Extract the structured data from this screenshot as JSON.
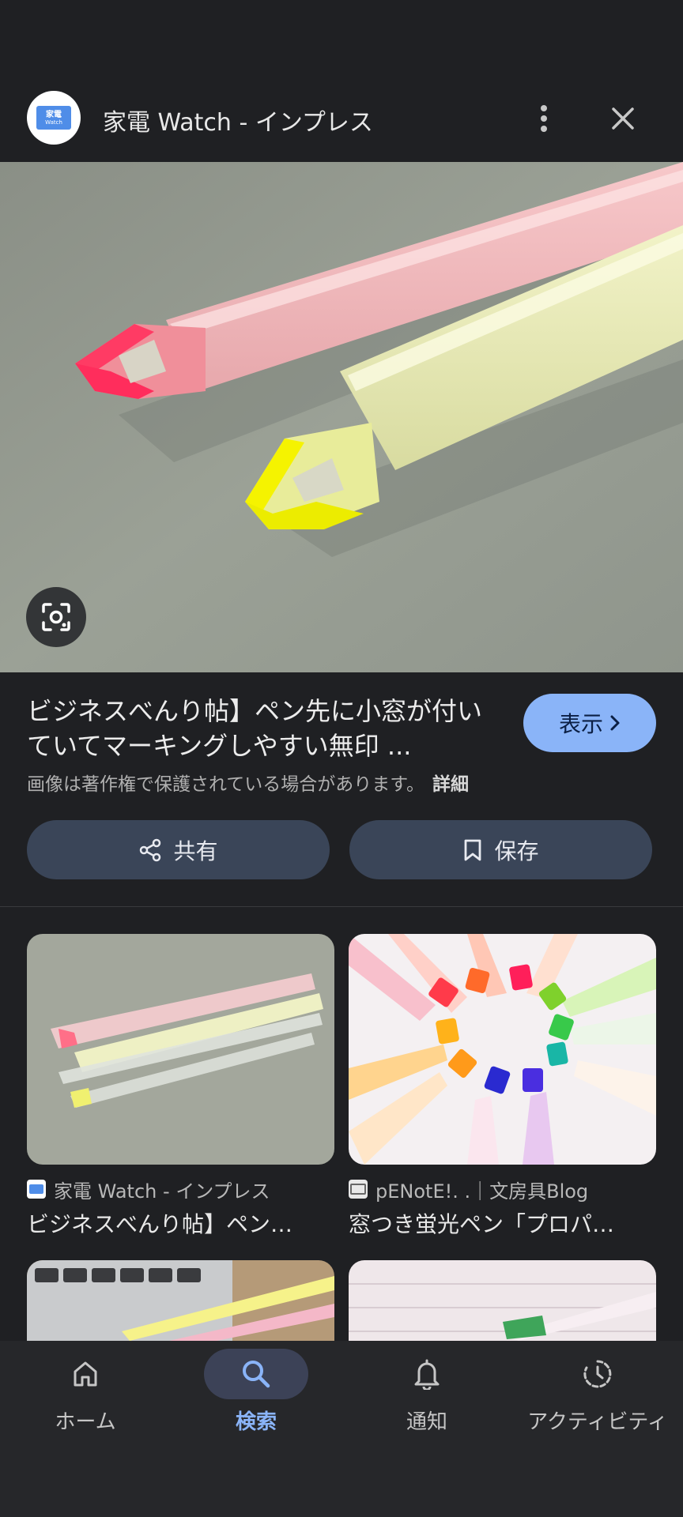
{
  "header": {
    "site_title": "家電 Watch - インプレス",
    "logo_line1": "家電",
    "logo_line2": "Watch"
  },
  "result": {
    "title": "ビジネスべんり帖】ペン先に小窓が付いていてマーキングしやすい無印 ...",
    "view_label": "表示",
    "copyright_notice": "画像は著作権で保護されている場合があります。",
    "details_label": "詳細"
  },
  "actions": {
    "share_label": "共有",
    "save_label": "保存"
  },
  "related": [
    {
      "source": "家電 Watch - インプレス",
      "title": "ビジネスべんり帖】ペン…"
    },
    {
      "source": "pENotE!. .｜文房具Blog",
      "title": "窓つき蛍光ペン「プロパ…"
    }
  ],
  "nav": {
    "items": [
      {
        "label": "ホーム",
        "icon": "home-icon"
      },
      {
        "label": "検索",
        "icon": "search-icon",
        "active": true
      },
      {
        "label": "通知",
        "icon": "bell-icon"
      },
      {
        "label": "アクティビティ",
        "icon": "activity-icon"
      }
    ]
  },
  "colors": {
    "background": "#1f2023",
    "accent": "#8ab4f8",
    "action_button": "#3a4558"
  }
}
